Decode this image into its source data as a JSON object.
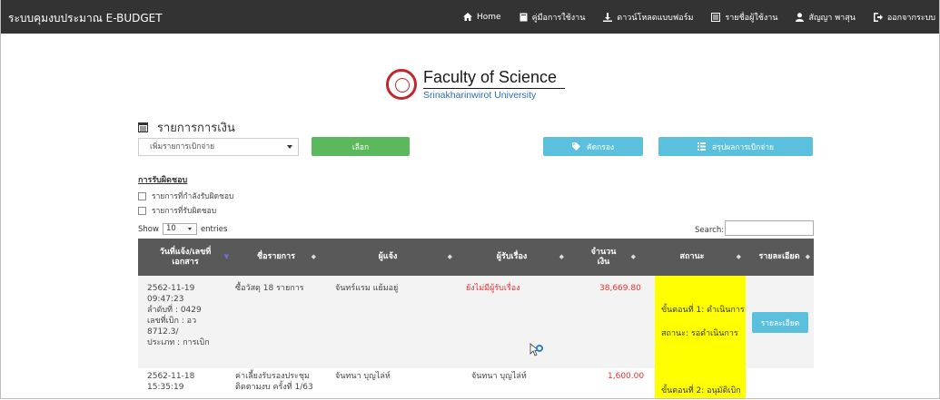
{
  "navbar": {
    "brand": "ระบบคุมงบประมาณ E-BUDGET",
    "items": [
      {
        "label": "Home",
        "icon": "home-icon"
      },
      {
        "label": "คู่มือการใช้งาน",
        "icon": "book-icon"
      },
      {
        "label": "ดาวน์โหลดแบบฟอร์ม",
        "icon": "download-icon"
      },
      {
        "label": "รายชื่อผู้ใช้งาน",
        "icon": "list-icon"
      },
      {
        "label": "สัญญา พาสุน",
        "icon": "user-icon"
      },
      {
        "label": "ออกจากระบบ",
        "icon": "logout-icon"
      }
    ]
  },
  "logo": {
    "title": "Faculty of Science",
    "subtitle": "Srinakharinwirot University",
    "icon": "university-seal-icon"
  },
  "section": {
    "title": "รายการการเงิน",
    "icon": "list-icon"
  },
  "controls": {
    "select_value": "เพิ่มรายการเบิกจ่าย",
    "select_button": "เลือก",
    "filter_button": "คัดกรอง",
    "summary_button": "สรุปผลการเบิกจ่าย"
  },
  "responsibility": {
    "label": "การรับผิดชอบ",
    "options": [
      "รายการที่กำลังรับผิดชอบ",
      "รายการที่รับผิดชอบ"
    ]
  },
  "table_controls": {
    "show_label": "Show",
    "entries_value": "10",
    "entries_label": "entries",
    "search_label": "Search:"
  },
  "table": {
    "headers": [
      "วันที่แจ้ง/เลขที่เอกสาร",
      "ชื่อรายการ",
      "ผู้แจ้ง",
      "ผู้รับเรื่อง",
      "จำนวนเงิน",
      "สถานะ",
      "รายละเอียด"
    ],
    "rows": [
      {
        "date_lines": [
          "2562-11-19",
          "09:47:23",
          "ลำดับที่ : 0429",
          "เลขที่เบิก : อว",
          "8712.3/",
          "ประเภท : การเบิก"
        ],
        "item": "ซื้อวัสดุ 18 รายการ",
        "reporter": "จันทร์แรม แย้มอยู่",
        "receiver": "ยังไม่มีผู้รับเรื่อง",
        "amount": "38,669.80",
        "status_step": "ขั้นตอนที่ 1: ดำเนินการ",
        "status_state": "สถานะ: รอดำเนินการ",
        "detail_button": "รายละเอียด"
      },
      {
        "date_lines": [
          "2562-11-18",
          "15:35:19"
        ],
        "item_lines": [
          "ค่าเลี้ยงรับรองประชุม",
          "ติดตามงบ ครั้งที่ 1/63"
        ],
        "reporter": "จันทนา บุญไล่ห์",
        "receiver": "จันทนา บุญไล่ห์",
        "amount": "1,600.00",
        "status_step": "ขั้นตอนที่ 2: อนุมัติเบิก"
      }
    ]
  },
  "colors": {
    "navbar": "#333333",
    "green": "#5cb85c",
    "cyan": "#5bc0de",
    "table_header": "#595959",
    "status_yellow": "#ffff00",
    "alert_red": "#e8302e"
  }
}
